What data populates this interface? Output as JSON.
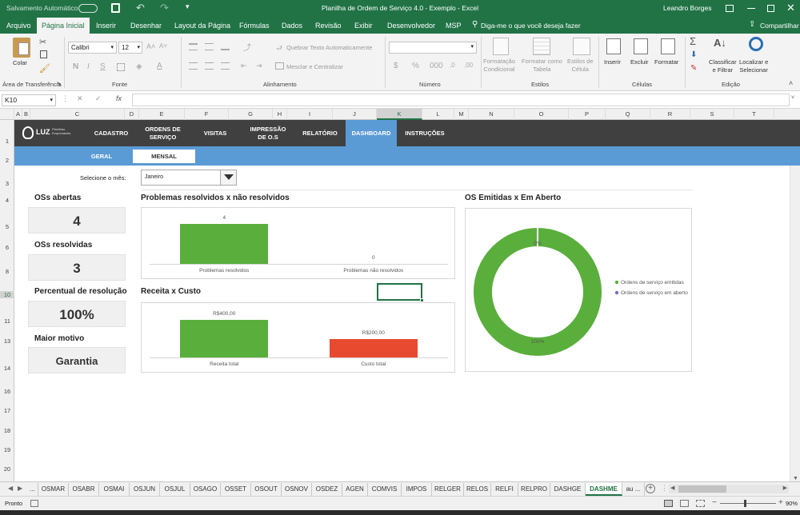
{
  "titlebar": {
    "autosave": "Salvamento Automático",
    "title": "Planilha de Ordem de Serviço 4.0 - Exemplo  -  Excel",
    "user": "Leandro Borges"
  },
  "ribbon_tabs": [
    "Arquivo",
    "Página Inicial",
    "Inserir",
    "Desenhar",
    "Layout da Página",
    "Fórmulas",
    "Dados",
    "Revisão",
    "Exibir",
    "Desenvolvedor",
    "MSP"
  ],
  "tell_me": "Diga-me o que você deseja fazer",
  "share": "Compartilhar",
  "ribbon": {
    "paste": "Colar",
    "font_name": "Calibri",
    "font_size": "12",
    "bold": "N",
    "italic": "I",
    "underline": "S",
    "wrap_text": "Quebrar Texto Automaticamente",
    "merge": "Mesclar e Centralizar",
    "cond_format": [
      "Formatação",
      "Condicional"
    ],
    "format_table": [
      "Formatar como",
      "Tabela"
    ],
    "cell_styles": [
      "Estilos de",
      "Célula"
    ],
    "insert": "Inserir",
    "delete": "Excluir",
    "format": "Formatar",
    "sort": [
      "Classificar",
      "e Filtrar"
    ],
    "find": [
      "Localizar e",
      "Selecionar"
    ],
    "groups": [
      "Área de Transferência",
      "Fonte",
      "Alinhamento",
      "Número",
      "Estilos",
      "Células",
      "Edição"
    ]
  },
  "formula_bar": {
    "name_box": "K10",
    "fx": "fx",
    "value": ""
  },
  "columns": [
    "A",
    "B",
    "C",
    "D",
    "E",
    "F",
    "G",
    "H",
    "I",
    "J",
    "K",
    "L",
    "M",
    "N",
    "O",
    "P",
    "Q",
    "R",
    "S",
    "T"
  ],
  "rows": [
    "1",
    "2",
    "3",
    "4",
    "5",
    "6",
    "7",
    "8",
    "9",
    "10",
    "11",
    "12",
    "13",
    "14",
    "15",
    "16",
    "17",
    "18",
    "19",
    "20"
  ],
  "dashboard": {
    "logo": "LUZ",
    "logo_sub": [
      "Planilhas",
      "Empresariais"
    ],
    "nav": [
      "CADASTRO",
      "ORDENS DE SERVIÇO",
      "VISITAS",
      "IMPRESSÃO DE O.S",
      "RELATÓRIO",
      "DASHBOARD",
      "INSTRUÇÕES"
    ],
    "nav_active": "DASHBOARD",
    "subnav": [
      "GERAL",
      "MENSAL"
    ],
    "month_label": "Selecione o mês:",
    "month_value": "Janeiro",
    "kpis": [
      {
        "title": "OSs abertas",
        "value": "4"
      },
      {
        "title": "OSs resolvidas",
        "value": "3"
      },
      {
        "title": "Percentual de resolução",
        "value": "100%"
      },
      {
        "title": "Maior motivo",
        "value": "Garantia"
      }
    ]
  },
  "chart_data": [
    {
      "type": "bar",
      "title": "Problemas resolvidos x não resolvidos",
      "categories": [
        "Problemas resolvidos",
        "Problemas não resolvidos"
      ],
      "values": [
        4,
        0
      ],
      "data_labels": [
        "4",
        "0"
      ],
      "colors": [
        "#5aaf3c",
        "#5aaf3c"
      ]
    },
    {
      "type": "bar",
      "title": "Receita x Custo",
      "categories": [
        "Receita total",
        "Custo total"
      ],
      "values": [
        400,
        200
      ],
      "data_labels": [
        "R$400,00",
        "R$200,00"
      ],
      "colors": [
        "#5aaf3c",
        "#e84a2f"
      ]
    },
    {
      "type": "pie",
      "title": "OS Emitidas x Em Aberto",
      "categories": [
        "Ordens de serviço emitidas",
        "Ordens de serviço em aberto"
      ],
      "values": [
        100,
        0
      ],
      "data_labels": [
        "100%",
        "0%"
      ],
      "colors": [
        "#5aaf3c",
        "#7f6fb3"
      ],
      "legend": "right"
    }
  ],
  "sheet_tabs": [
    "...",
    "OSMAR",
    "OSABR",
    "OSMAI",
    "OSJUN",
    "OSJUL",
    "OSAGO",
    "OSSET",
    "OSOUT",
    "OSNOV",
    "OSDEZ",
    "AGEN",
    "COMVIS",
    "IMPOS",
    "RELGER",
    "RELOS",
    "RELFI",
    "RELPRO",
    "DASHGE",
    "DASHME",
    "au ..."
  ],
  "active_sheet": "DASHME",
  "status": {
    "ready": "Pronto",
    "zoom": "90%"
  }
}
